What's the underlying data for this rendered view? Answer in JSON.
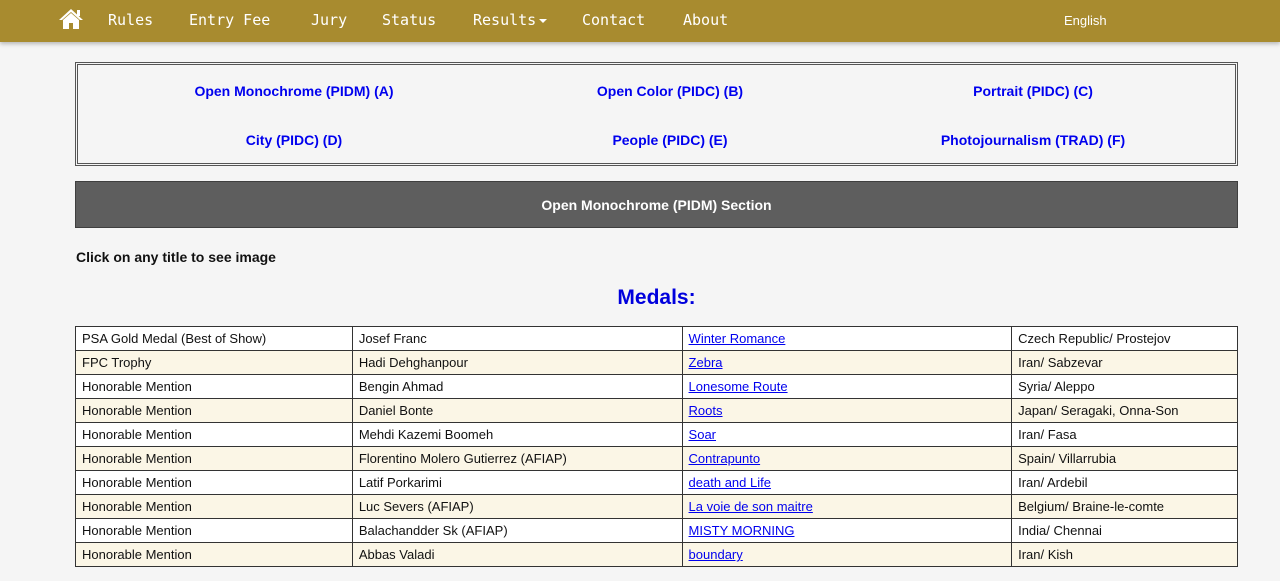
{
  "nav": {
    "home_icon": "home-icon",
    "items": [
      "Rules",
      "Entry Fee",
      "Jury",
      "Status",
      "Results",
      "Contact",
      "About"
    ],
    "language": "English"
  },
  "sections": [
    "Open Monochrome (PIDM) (A)",
    "Open Color (PIDC) (B)",
    "Portrait (PIDC) (C)",
    "City (PIDC) (D)",
    "People (PIDC) (E)",
    "Photojournalism (TRAD) (F)"
  ],
  "section_header": "Open Monochrome (PIDM) Section",
  "instructions": "Click on any title to see image",
  "medals_title": "Medals:",
  "rows": [
    {
      "award": "PSA Gold Medal (Best of Show)",
      "author": "Josef Franc",
      "title": "Winter Romance",
      "location": "Czech Republic/ Prostejov"
    },
    {
      "award": "FPC Trophy",
      "author": "Hadi Dehghanpour",
      "title": "Zebra",
      "location": "Iran/ Sabzevar"
    },
    {
      "award": "Honorable Mention",
      "author": "Bengin Ahmad",
      "title": "Lonesome Route",
      "location": "Syria/ Aleppo"
    },
    {
      "award": "Honorable Mention",
      "author": "Daniel Bonte",
      "title": "Roots",
      "location": "Japan/ Seragaki, Onna-Son"
    },
    {
      "award": "Honorable Mention",
      "author": "Mehdi Kazemi Boomeh",
      "title": "Soar",
      "location": "Iran/ Fasa"
    },
    {
      "award": "Honorable Mention",
      "author": "Florentino Molero Gutierrez (AFIAP)",
      "title": "Contrapunto",
      "location": "Spain/ Villarrubia"
    },
    {
      "award": "Honorable Mention",
      "author": "Latif Porkarimi",
      "title": "death and Life",
      "location": "Iran/ Ardebil"
    },
    {
      "award": "Honorable Mention",
      "author": "Luc Severs (AFIAP)",
      "title": "La voie de son maitre",
      "location": "Belgium/ Braine-le-comte"
    },
    {
      "award": "Honorable Mention",
      "author": "Balachandder Sk (AFIAP)",
      "title": "MISTY MORNING",
      "location": "India/ Chennai"
    },
    {
      "award": "Honorable Mention",
      "author": "Abbas Valadi",
      "title": "boundary",
      "location": "Iran/ Kish"
    }
  ]
}
